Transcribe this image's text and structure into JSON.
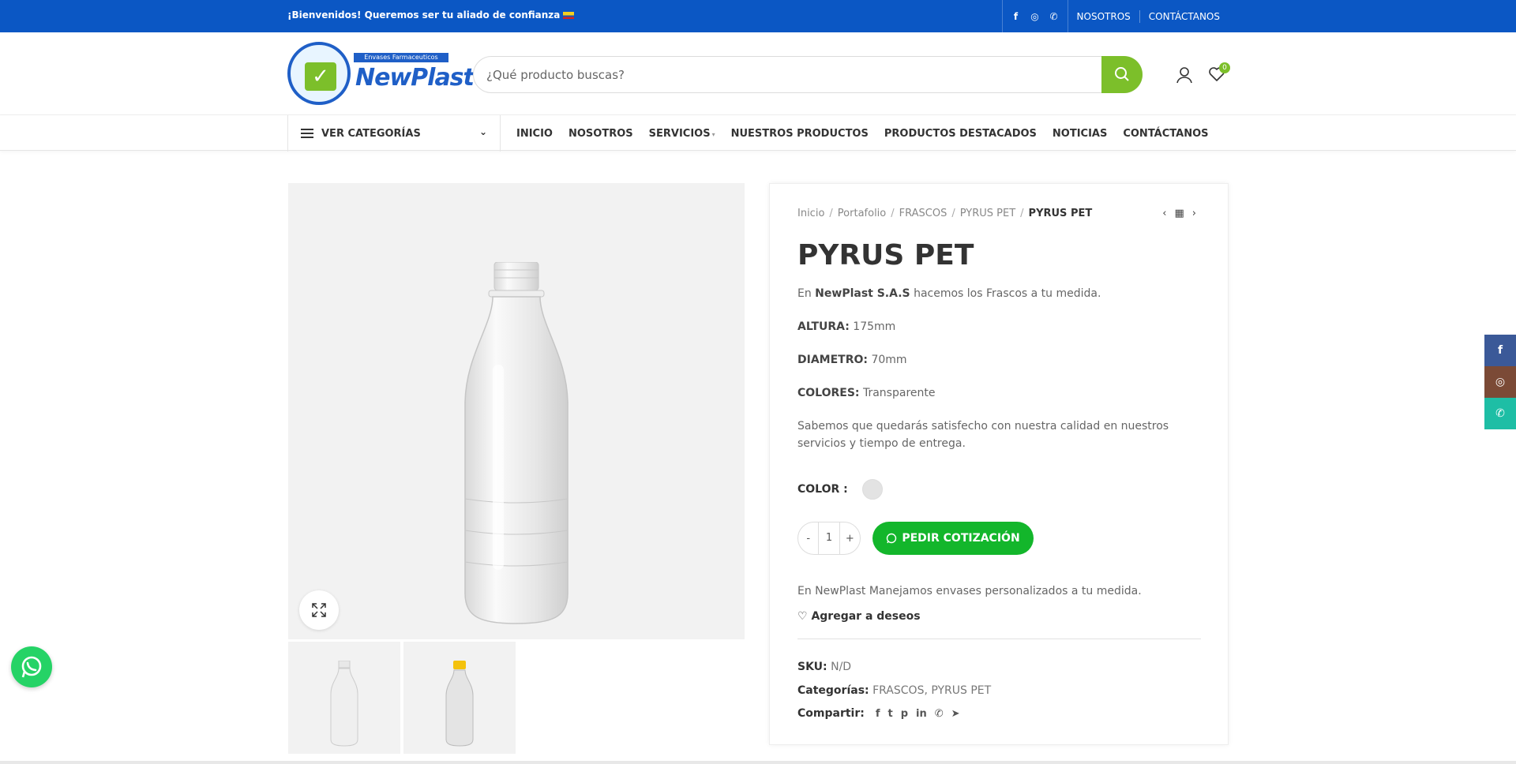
{
  "topbar": {
    "welcome": "¡Bienvenidos! Queremos ser tu aliado de confianza",
    "social": [
      "f",
      "◎",
      "✆"
    ],
    "links": [
      "NOSOTROS",
      "CONTÁCTANOS"
    ]
  },
  "header": {
    "logo_ribbon": "Envases Farmaceuticos",
    "logo_brand": "NewPlast",
    "search_placeholder": "¿Qué producto buscas?",
    "wishlist_count": "0"
  },
  "nav": {
    "categories_label": "VER CATEGORÍAS",
    "items": [
      "INICIO",
      "NOSOTROS",
      "SERVICIOS",
      "NUESTROS PRODUCTOS",
      "PRODUCTOS DESTACADOS",
      "NOTICIAS",
      "CONTÁCTANOS"
    ]
  },
  "breadcrumb": [
    "Inicio",
    "Portafolio",
    "FRASCOS",
    "PYRUS PET",
    "PYRUS PET"
  ],
  "product": {
    "title": "PYRUS PET",
    "intro_pre": "En ",
    "intro_brand": "NewPlast S.A.S",
    "intro_post": " hacemos los Frascos a tu medida.",
    "altura_label": "ALTURA:",
    "altura_value": " 175mm",
    "diametro_label": "DIAMETRO:",
    "diametro_value": " 70mm",
    "colores_label": "COLORES:",
    "colores_value": " Transparente",
    "promise": "Sabemos que quedarás satisfecho con nuestra calidad en nuestros servicios y tiempo de entrega.",
    "color_label": "COLOR :",
    "qty_minus": "-",
    "qty_value": "1",
    "qty_plus": "+",
    "quote_button": "PEDIR COTIZACIÓN",
    "custom_text": "En NewPlast Manejamos envases personalizados a tu medida.",
    "wishlist": "Agregar a deseos",
    "sku_label": "SKU:",
    "sku_value": "N/D",
    "categories_label": "Categorías:",
    "categories_value": "FRASCOS, PYRUS PET",
    "share_label": "Compartir:",
    "share_icons": [
      "f",
      "t",
      "p",
      "in",
      "✆",
      "➤"
    ]
  },
  "sticky": [
    "f",
    "◎",
    "✆"
  ],
  "colors": {
    "brand_blue": "#0b57c4",
    "accent_green": "#7cbf2a",
    "quote_green": "#13b62b"
  }
}
